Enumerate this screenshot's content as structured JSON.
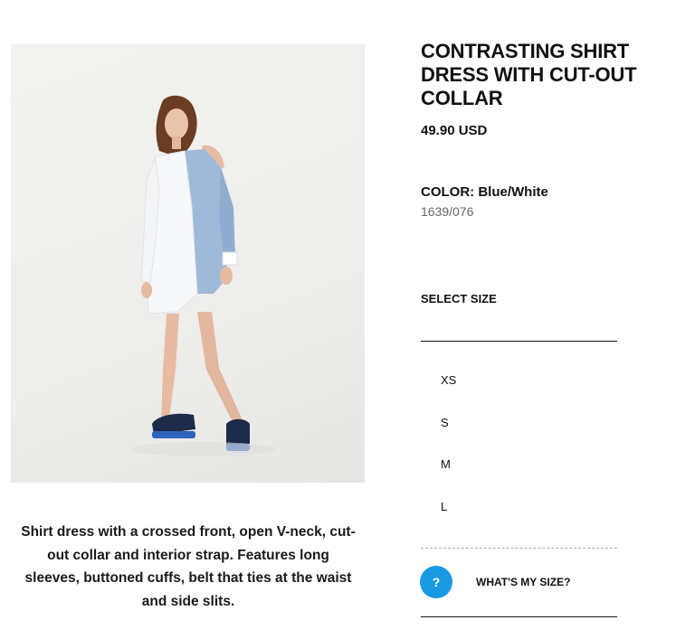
{
  "product": {
    "title": "CONTRASTING SHIRT DRESS WITH CUT-OUT COLLAR",
    "price": "49.90 USD",
    "color": "COLOR: Blue/White",
    "reference": "1639/076",
    "description": "Shirt dress with a crossed front, open V-neck, cut-out collar and interior strap. Features long sleeves, buttoned cuffs, belt that ties at the waist and side slits.",
    "image_icon": "model-wearing-dress"
  },
  "size_selector": {
    "label": "SELECT SIZE",
    "sizes": [
      "XS",
      "S",
      "M",
      "L"
    ]
  },
  "size_help": {
    "icon_text": "?",
    "label": "WHAT'S MY SIZE?",
    "accent": "#1a9ae2"
  }
}
